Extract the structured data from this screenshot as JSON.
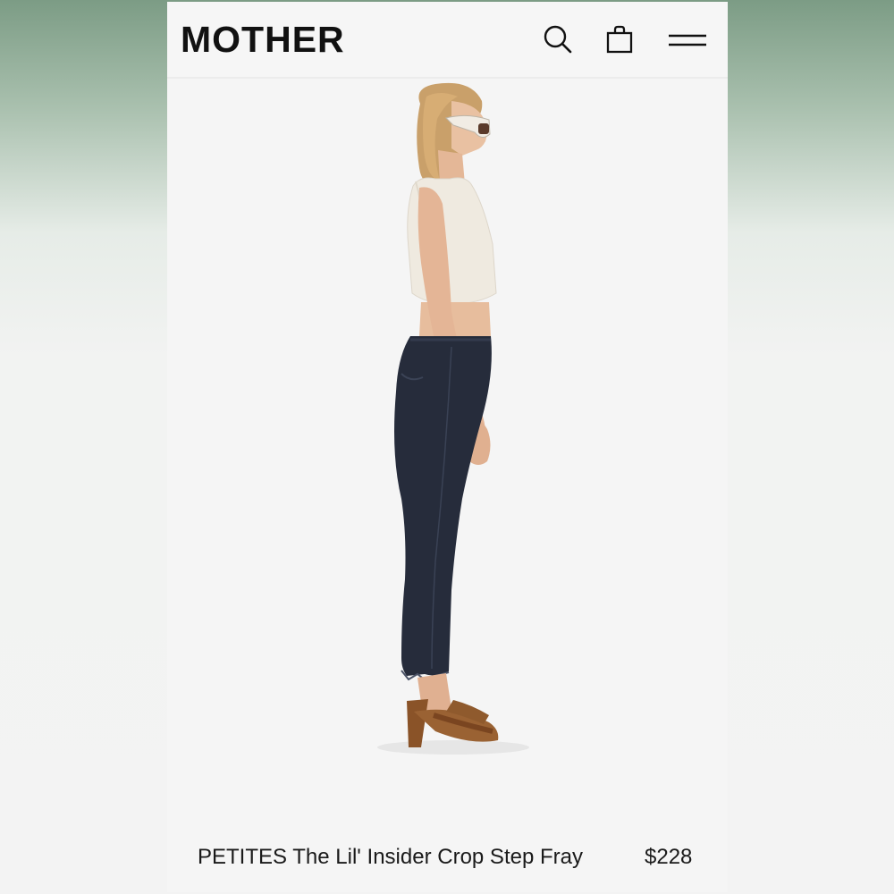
{
  "header": {
    "logo_text": "MOTHER",
    "search_icon": "search-icon",
    "bag_icon": "shopping-bag-icon",
    "menu_icon": "hamburger-menu-icon"
  },
  "product": {
    "name": "PETITES The Lil' Insider Crop Step Fray",
    "price": "$228"
  },
  "colors": {
    "background_top": "#7c9c85",
    "screen_background": "#f5f5f5",
    "text": "#1a1a1a",
    "denim": "#262c3b",
    "top": "#efeae0",
    "sandal": "#8a5328"
  }
}
